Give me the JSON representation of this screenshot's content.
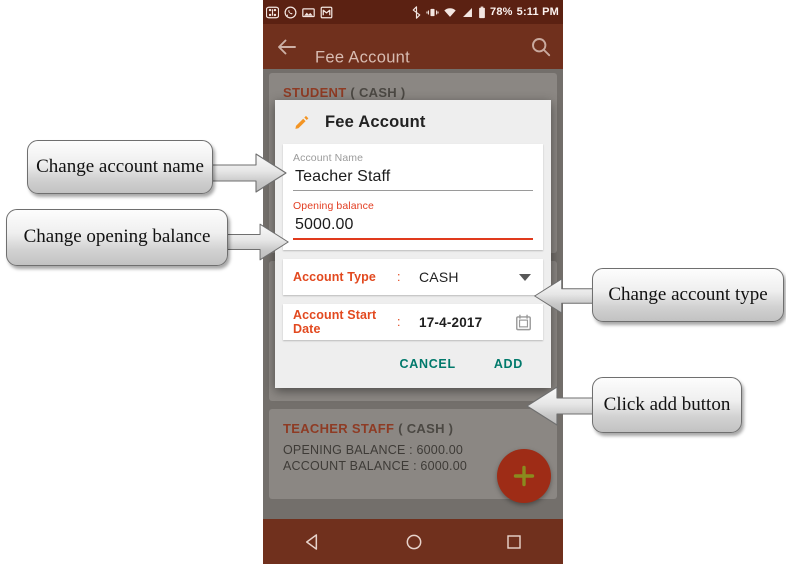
{
  "statusbar": {
    "icons_left": [
      "apps-grid-icon",
      "whatsapp-icon",
      "screenshot-image-icon",
      "gmail-icon"
    ],
    "icons_right": [
      "bluetooth-icon",
      "vibrate-icon",
      "wifi-icon",
      "signal-icon",
      "battery-icon"
    ],
    "battery": "78%",
    "time": "5:11 PM"
  },
  "appbar": {
    "title": "Fee Account",
    "back_icon": "back-arrow-icon",
    "search_icon": "search-icon"
  },
  "background_list": {
    "cards": [
      {
        "name": "STUDENT",
        "type": "( CASH )",
        "lines": []
      },
      {
        "name": "TEACHER STAFF",
        "type": "( CASH )",
        "lines": [
          "OPENING BALANCE : 6000.00",
          "ACCOUNT BALANCE : 6000.00"
        ]
      }
    ],
    "fab_icon": "add-plus-icon"
  },
  "dialog": {
    "edit_icon": "pencil-edit-icon",
    "title": "Fee Account",
    "account_name": {
      "label": "Account Name",
      "value": "Teacher Staff"
    },
    "opening_balance": {
      "label": "Opening balance",
      "value": "5000.00"
    },
    "account_type": {
      "label": "Account Type",
      "colon": ":",
      "value": "CASH",
      "dropdown_icon": "chevron-down-icon"
    },
    "account_start_date": {
      "label": "Account Start Date",
      "colon": ":",
      "value": "17-4-2017",
      "calendar_icon": "calendar-icon"
    },
    "cancel_label": "CANCEL",
    "add_label": "ADD"
  },
  "navbar": {
    "back_icon": "nav-back-triangle-icon",
    "home_icon": "nav-home-circle-icon",
    "recents_icon": "nav-recents-square-icon"
  },
  "callouts": [
    {
      "text": "Change account name"
    },
    {
      "text": "Change opening balance"
    },
    {
      "text": "Change account type"
    },
    {
      "text": "Click add button"
    }
  ],
  "colors": {
    "statusbar": "#5b2112",
    "appbar": "#70301d",
    "accent_red": "#e2491f",
    "action_teal": "#00796b",
    "pencil_orange": "#f39423",
    "fab": "#9e2c16"
  }
}
